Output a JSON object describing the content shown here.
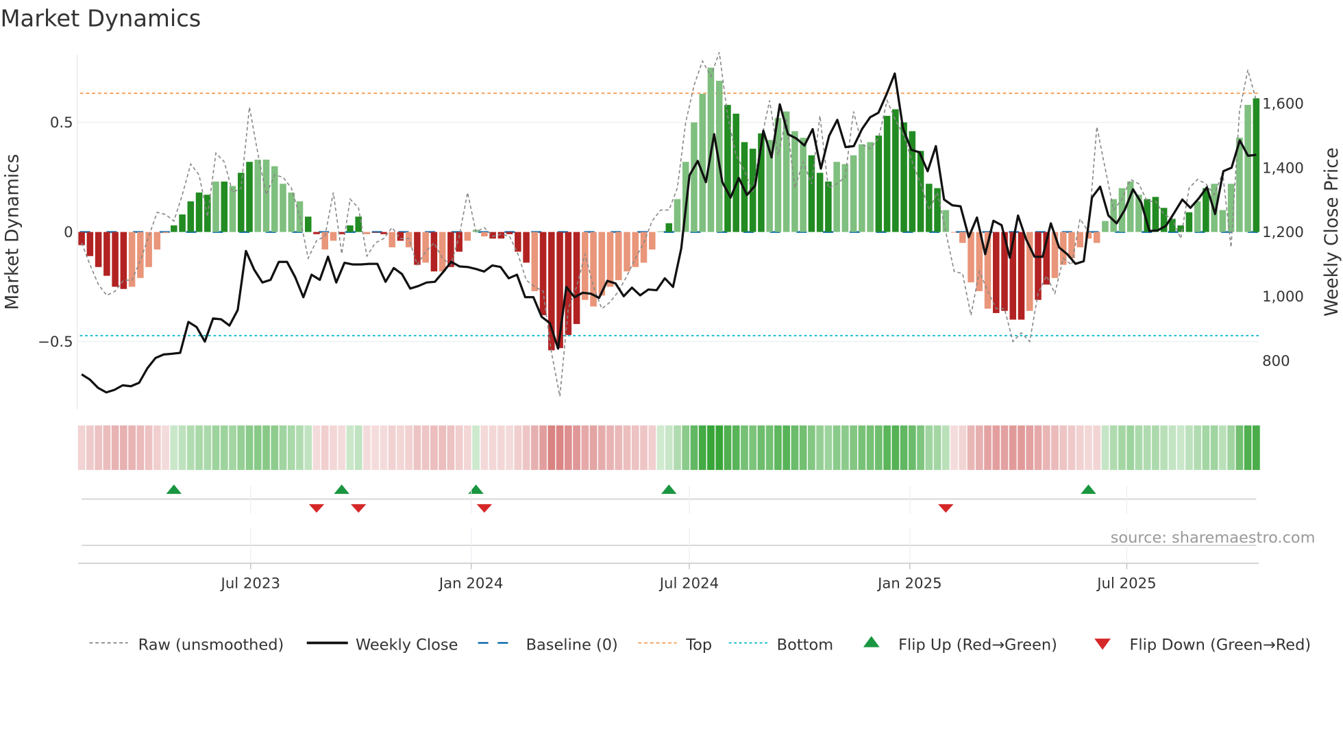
{
  "chart_data": {
    "type": "bar",
    "title": "Market Dynamics",
    "ylabel": "Market Dynamics",
    "y2label": "Weekly Close Price",
    "ylim": [
      -0.83,
      0.82
    ],
    "y2lim": [
      644,
      1738
    ],
    "yticks": [
      {
        "v": 0.5,
        "label": "0.5"
      },
      {
        "v": 0,
        "label": "0"
      },
      {
        "v": -0.5,
        "label": "−0.5"
      }
    ],
    "y2ticks": [
      {
        "v": 1600,
        "label": "1,600"
      },
      {
        "v": 1400,
        "label": "1,400"
      },
      {
        "v": 1200,
        "label": "1,200"
      },
      {
        "v": 1000,
        "label": "1,000"
      },
      {
        "v": 800,
        "label": "800"
      }
    ],
    "start_week": "2023-02-10",
    "frequency": "weekly",
    "xticks": [
      {
        "date": "2023-07-01",
        "label": "Jul 2023"
      },
      {
        "date": "2024-01-01",
        "label": "Jan 2024"
      },
      {
        "date": "2024-07-01",
        "label": "Jul 2024"
      },
      {
        "date": "2025-01-01",
        "label": "Jan 2025"
      },
      {
        "date": "2025-07-01",
        "label": "Jul 2025"
      }
    ],
    "top_level": 0.633,
    "bottom_level": -0.473,
    "baseline": 0,
    "colors": {
      "dark_green": "#228b22",
      "light_green": "#7fbf7f",
      "dark_red": "#b22222",
      "light_red": "#e9967a",
      "raw": "#888888",
      "close": "#111111",
      "baseline": "#1f77b4",
      "top": "#f4a460",
      "bottom": "#17becf",
      "flip_up": "#1a9641",
      "flip_down": "#d62728"
    },
    "momentum": [
      -0.06,
      -0.11,
      -0.16,
      -0.2,
      -0.25,
      -0.26,
      -0.25,
      -0.21,
      -0.16,
      -0.08,
      -0.005,
      0.03,
      0.08,
      0.14,
      0.18,
      0.17,
      0.23,
      0.23,
      0.21,
      0.27,
      0.32,
      0.33,
      0.33,
      0.3,
      0.22,
      0.18,
      0.14,
      0.07,
      -0.01,
      -0.08,
      -0.04,
      -0.01,
      0.03,
      0.07,
      -0.01,
      -0.003,
      -0.01,
      -0.07,
      -0.04,
      -0.07,
      -0.15,
      -0.14,
      -0.18,
      -0.18,
      -0.16,
      -0.09,
      -0.04,
      0.01,
      -0.02,
      -0.03,
      -0.03,
      -0.01,
      -0.09,
      -0.14,
      -0.27,
      -0.38,
      -0.54,
      -0.53,
      -0.47,
      -0.42,
      -0.31,
      -0.34,
      -0.29,
      -0.25,
      -0.22,
      -0.18,
      -0.16,
      -0.14,
      -0.08,
      0.003,
      0.04,
      0.15,
      0.32,
      0.5,
      0.63,
      0.75,
      0.69,
      0.58,
      0.54,
      0.41,
      0.38,
      0.45,
      0.42,
      0.52,
      0.55,
      0.46,
      0.43,
      0.35,
      0.27,
      0.23,
      0.32,
      0.31,
      0.35,
      0.4,
      0.41,
      0.44,
      0.53,
      0.56,
      0.5,
      0.46,
      0.37,
      0.22,
      0.2,
      0.1,
      -0.003,
      -0.05,
      -0.23,
      -0.27,
      -0.35,
      -0.37,
      -0.36,
      -0.4,
      -0.4,
      -0.36,
      -0.31,
      -0.24,
      -0.21,
      -0.15,
      -0.12,
      -0.07,
      -0.03,
      -0.05,
      0.05,
      0.15,
      0.2,
      0.23,
      0.17,
      0.15,
      0.16,
      0.11,
      0.06,
      0.03,
      0.09,
      0.14,
      0.2,
      0.22,
      0.1,
      0.22,
      0.43,
      0.58,
      0.61
    ],
    "momentum_shade": "ddddddllllldddddldlddllllllddlldddlddldldldlddllldddddldddddlllllllllldlllllldddddllllldddlllllddddddddllllllddddlddlllllllllllddddddldlllllddddddddd",
    "raw": [
      -0.05,
      -0.15,
      -0.24,
      -0.29,
      -0.27,
      -0.22,
      -0.22,
      -0.13,
      -0.02,
      0.09,
      0.08,
      0.05,
      0.17,
      0.31,
      0.26,
      0.07,
      0.36,
      0.32,
      0.18,
      0.2,
      0.57,
      0.36,
      0.17,
      0.26,
      0.25,
      0.2,
      0.07,
      -0.12,
      -0.04,
      -0.02,
      0.18,
      -0.1,
      0.15,
      0.11,
      -0.11,
      -0.05,
      -0.03,
      0.02,
      -0.03,
      -0.03,
      -0.15,
      -0.09,
      -0.05,
      -0.12,
      -0.15,
      -0.02,
      0.18,
      0.0,
      0.02,
      -0.02,
      -0.01,
      -0.02,
      -0.1,
      -0.22,
      -0.25,
      -0.27,
      -0.55,
      -0.75,
      -0.35,
      -0.25,
      -0.1,
      -0.25,
      -0.35,
      -0.32,
      -0.27,
      -0.2,
      -0.12,
      -0.05,
      0.05,
      0.1,
      0.1,
      0.2,
      0.5,
      0.67,
      0.78,
      0.71,
      0.82,
      0.53,
      0.35,
      0.28,
      0.18,
      0.42,
      0.6,
      0.35,
      0.52,
      0.2,
      0.32,
      0.22,
      0.53,
      0.2,
      0.22,
      0.25,
      0.55,
      0.4,
      0.38,
      0.43,
      0.6,
      0.51,
      0.44,
      0.32,
      0.22,
      0.1,
      0.18,
      0.0,
      -0.18,
      -0.19,
      -0.38,
      -0.18,
      -0.27,
      -0.35,
      -0.35,
      -0.5,
      -0.46,
      -0.5,
      -0.28,
      -0.2,
      -0.28,
      -0.12,
      -0.15,
      0.06,
      0.0,
      0.48,
      0.29,
      0.1,
      0.15,
      0.24,
      0.22,
      0.14,
      0.14,
      0.08,
      0.06,
      -0.03,
      0.2,
      0.24,
      0.22,
      0.17,
      0.27,
      -0.07,
      0.55,
      0.74,
      0.6
    ],
    "close": [
      757,
      741,
      715,
      701,
      709,
      723,
      720,
      731,
      776,
      808,
      819,
      821,
      824,
      920,
      904,
      859,
      931,
      928,
      909,
      957,
      1141,
      1083,
      1043,
      1051,
      1107,
      1107,
      1059,
      997,
      1067,
      1051,
      1123,
      1043,
      1104,
      1099,
      1099,
      1101,
      1101,
      1045,
      1088,
      1069,
      1024,
      1032,
      1043,
      1045,
      1075,
      1107,
      1093,
      1091,
      1085,
      1077,
      1096,
      1091,
      1056,
      1067,
      997,
      997,
      936,
      917,
      837,
      1029,
      997,
      1011,
      1008,
      995,
      1048,
      1040,
      1000,
      1027,
      1003,
      1021,
      1019,
      1056,
      1029,
      1149,
      1376,
      1421,
      1355,
      1504,
      1355,
      1307,
      1368,
      1315,
      1344,
      1515,
      1432,
      1597,
      1504,
      1491,
      1469,
      1520,
      1397,
      1499,
      1549,
      1464,
      1467,
      1520,
      1557,
      1571,
      1629,
      1693,
      1523,
      1456,
      1448,
      1389,
      1467,
      1301,
      1283,
      1280,
      1184,
      1245,
      1131,
      1235,
      1221,
      1120,
      1251,
      1176,
      1123,
      1123,
      1227,
      1152,
      1131,
      1101,
      1109,
      1307,
      1341,
      1251,
      1227,
      1269,
      1333,
      1291,
      1203,
      1205,
      1219,
      1259,
      1301,
      1275,
      1304,
      1339,
      1256,
      1389,
      1400,
      1485,
      1437,
      1440
    ],
    "flip_up": [
      "2023-04-28",
      "2023-09-15",
      "2024-01-05",
      "2024-06-14",
      "2025-05-30"
    ],
    "flip_down": [
      "2023-08-25",
      "2023-09-29",
      "2024-01-12",
      "2025-01-31"
    ],
    "legend": {
      "position": "bottom",
      "items": [
        {
          "key": "raw",
          "label": "Raw (unsmoothed)"
        },
        {
          "key": "close",
          "label": "Weekly Close"
        },
        {
          "key": "baseline",
          "label": "Baseline (0)"
        },
        {
          "key": "top",
          "label": "Top"
        },
        {
          "key": "bottom",
          "label": "Bottom"
        },
        {
          "key": "up",
          "label": "Flip Up (Red→Green)"
        },
        {
          "key": "down",
          "label": "Flip Down (Green→Red)"
        }
      ]
    },
    "source": "source: sharemaestro.com"
  }
}
